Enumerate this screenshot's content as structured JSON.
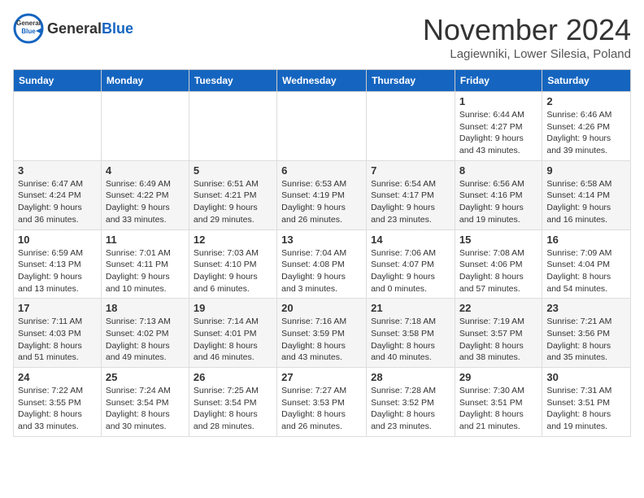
{
  "header": {
    "logo_general": "General",
    "logo_blue": "Blue",
    "month": "November 2024",
    "location": "Lagiewniki, Lower Silesia, Poland"
  },
  "days_of_week": [
    "Sunday",
    "Monday",
    "Tuesday",
    "Wednesday",
    "Thursday",
    "Friday",
    "Saturday"
  ],
  "weeks": [
    [
      {
        "day": "",
        "info": ""
      },
      {
        "day": "",
        "info": ""
      },
      {
        "day": "",
        "info": ""
      },
      {
        "day": "",
        "info": ""
      },
      {
        "day": "",
        "info": ""
      },
      {
        "day": "1",
        "info": "Sunrise: 6:44 AM\nSunset: 4:27 PM\nDaylight: 9 hours\nand 43 minutes."
      },
      {
        "day": "2",
        "info": "Sunrise: 6:46 AM\nSunset: 4:26 PM\nDaylight: 9 hours\nand 39 minutes."
      }
    ],
    [
      {
        "day": "3",
        "info": "Sunrise: 6:47 AM\nSunset: 4:24 PM\nDaylight: 9 hours\nand 36 minutes."
      },
      {
        "day": "4",
        "info": "Sunrise: 6:49 AM\nSunset: 4:22 PM\nDaylight: 9 hours\nand 33 minutes."
      },
      {
        "day": "5",
        "info": "Sunrise: 6:51 AM\nSunset: 4:21 PM\nDaylight: 9 hours\nand 29 minutes."
      },
      {
        "day": "6",
        "info": "Sunrise: 6:53 AM\nSunset: 4:19 PM\nDaylight: 9 hours\nand 26 minutes."
      },
      {
        "day": "7",
        "info": "Sunrise: 6:54 AM\nSunset: 4:17 PM\nDaylight: 9 hours\nand 23 minutes."
      },
      {
        "day": "8",
        "info": "Sunrise: 6:56 AM\nSunset: 4:16 PM\nDaylight: 9 hours\nand 19 minutes."
      },
      {
        "day": "9",
        "info": "Sunrise: 6:58 AM\nSunset: 4:14 PM\nDaylight: 9 hours\nand 16 minutes."
      }
    ],
    [
      {
        "day": "10",
        "info": "Sunrise: 6:59 AM\nSunset: 4:13 PM\nDaylight: 9 hours\nand 13 minutes."
      },
      {
        "day": "11",
        "info": "Sunrise: 7:01 AM\nSunset: 4:11 PM\nDaylight: 9 hours\nand 10 minutes."
      },
      {
        "day": "12",
        "info": "Sunrise: 7:03 AM\nSunset: 4:10 PM\nDaylight: 9 hours\nand 6 minutes."
      },
      {
        "day": "13",
        "info": "Sunrise: 7:04 AM\nSunset: 4:08 PM\nDaylight: 9 hours\nand 3 minutes."
      },
      {
        "day": "14",
        "info": "Sunrise: 7:06 AM\nSunset: 4:07 PM\nDaylight: 9 hours\nand 0 minutes."
      },
      {
        "day": "15",
        "info": "Sunrise: 7:08 AM\nSunset: 4:06 PM\nDaylight: 8 hours\nand 57 minutes."
      },
      {
        "day": "16",
        "info": "Sunrise: 7:09 AM\nSunset: 4:04 PM\nDaylight: 8 hours\nand 54 minutes."
      }
    ],
    [
      {
        "day": "17",
        "info": "Sunrise: 7:11 AM\nSunset: 4:03 PM\nDaylight: 8 hours\nand 51 minutes."
      },
      {
        "day": "18",
        "info": "Sunrise: 7:13 AM\nSunset: 4:02 PM\nDaylight: 8 hours\nand 49 minutes."
      },
      {
        "day": "19",
        "info": "Sunrise: 7:14 AM\nSunset: 4:01 PM\nDaylight: 8 hours\nand 46 minutes."
      },
      {
        "day": "20",
        "info": "Sunrise: 7:16 AM\nSunset: 3:59 PM\nDaylight: 8 hours\nand 43 minutes."
      },
      {
        "day": "21",
        "info": "Sunrise: 7:18 AM\nSunset: 3:58 PM\nDaylight: 8 hours\nand 40 minutes."
      },
      {
        "day": "22",
        "info": "Sunrise: 7:19 AM\nSunset: 3:57 PM\nDaylight: 8 hours\nand 38 minutes."
      },
      {
        "day": "23",
        "info": "Sunrise: 7:21 AM\nSunset: 3:56 PM\nDaylight: 8 hours\nand 35 minutes."
      }
    ],
    [
      {
        "day": "24",
        "info": "Sunrise: 7:22 AM\nSunset: 3:55 PM\nDaylight: 8 hours\nand 33 minutes."
      },
      {
        "day": "25",
        "info": "Sunrise: 7:24 AM\nSunset: 3:54 PM\nDaylight: 8 hours\nand 30 minutes."
      },
      {
        "day": "26",
        "info": "Sunrise: 7:25 AM\nSunset: 3:54 PM\nDaylight: 8 hours\nand 28 minutes."
      },
      {
        "day": "27",
        "info": "Sunrise: 7:27 AM\nSunset: 3:53 PM\nDaylight: 8 hours\nand 26 minutes."
      },
      {
        "day": "28",
        "info": "Sunrise: 7:28 AM\nSunset: 3:52 PM\nDaylight: 8 hours\nand 23 minutes."
      },
      {
        "day": "29",
        "info": "Sunrise: 7:30 AM\nSunset: 3:51 PM\nDaylight: 8 hours\nand 21 minutes."
      },
      {
        "day": "30",
        "info": "Sunrise: 7:31 AM\nSunset: 3:51 PM\nDaylight: 8 hours\nand 19 minutes."
      }
    ]
  ]
}
